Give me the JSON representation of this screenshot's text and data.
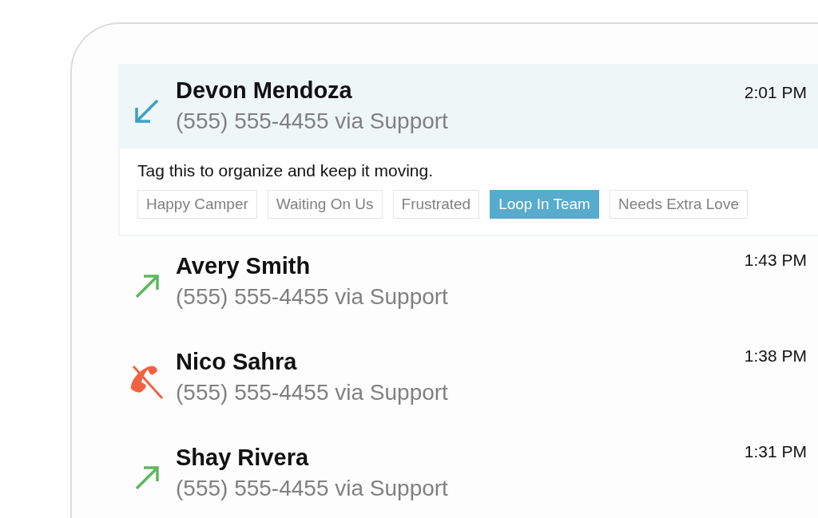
{
  "calls": [
    {
      "kind": "incoming",
      "name": "Devon Mendoza",
      "detail": "(555) 555-4455 via Support",
      "time": "2:01 PM",
      "selected": true,
      "tagging": {
        "prompt": "Tag this to organize and keep it moving.",
        "tags": [
          {
            "label": "Happy Camper",
            "selected": false
          },
          {
            "label": "Waiting On Us",
            "selected": false
          },
          {
            "label": "Frustrated",
            "selected": false
          },
          {
            "label": "Loop In Team",
            "selected": true
          },
          {
            "label": "Needs Extra Love",
            "selected": false
          }
        ]
      }
    },
    {
      "kind": "outgoing",
      "name": "Avery Smith",
      "detail": "(555) 555-4455 via Support",
      "time": "1:43 PM",
      "selected": false
    },
    {
      "kind": "missed",
      "name": "Nico Sahra",
      "detail": "(555) 555-4455 via Support",
      "time": "1:38 PM",
      "selected": false
    },
    {
      "kind": "outgoing",
      "name": "Shay Rivera",
      "detail": "(555) 555-4455 via Support",
      "time": "1:31 PM",
      "selected": false
    }
  ]
}
